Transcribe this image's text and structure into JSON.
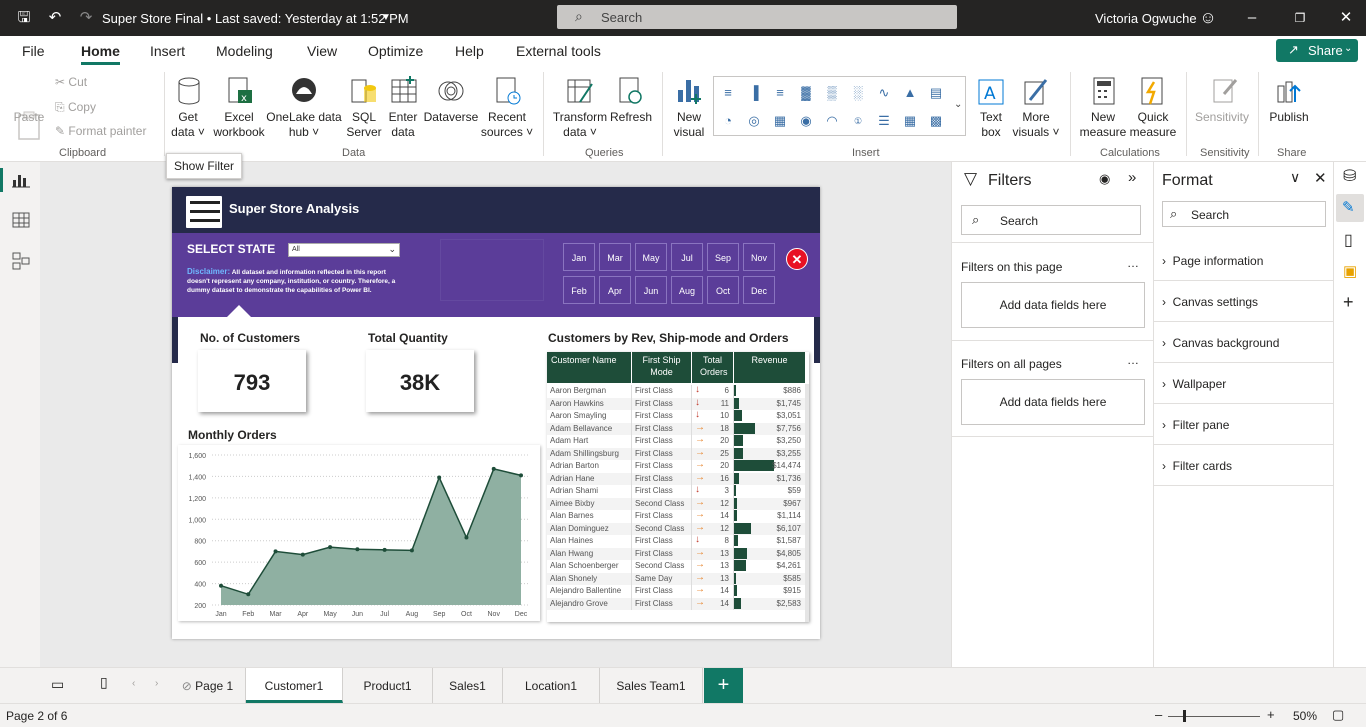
{
  "window": {
    "title": "Super Store Final • Last saved: Yesterday at 1:52 PM",
    "search_placeholder": "Search",
    "user_name": "Victoria Ogwuche"
  },
  "ribbon_tabs": [
    "File",
    "Home",
    "Insert",
    "Modeling",
    "View",
    "Optimize",
    "Help",
    "External tools"
  ],
  "share_label": "Share",
  "ribbon": {
    "clipboard": {
      "paste": "Paste",
      "cut": "Cut",
      "copy": "Copy",
      "format_painter": "Format painter",
      "group": "Clipboard"
    },
    "data": {
      "get_data": "Get data ˅",
      "excel": "Excel workbook",
      "onelake": "OneLake data hub ˅",
      "sql": "SQL Server",
      "enter": "Enter data",
      "dataverse": "Dataverse",
      "recent": "Recent sources ˅",
      "group": "Data"
    },
    "queries": {
      "transform": "Transform data ˅",
      "refresh": "Refresh",
      "group": "Queries"
    },
    "insert": {
      "new_visual": "New visual",
      "text_box": "Text box",
      "more_visuals": "More visuals ˅",
      "group": "Insert"
    },
    "calculations": {
      "new_measure": "New measure",
      "quick_measure": "Quick measure",
      "group": "Calculations"
    },
    "sensitivity": {
      "label": "Sensitivity",
      "group": "Sensitivity"
    },
    "share": {
      "publish": "Publish",
      "group": "Share"
    }
  },
  "tooltip": "Show Filter",
  "report": {
    "title": "Super Store Analysis",
    "select_state": "SELECT STATE",
    "state_value": "All",
    "disclaimer_label": "Disclaimer:",
    "disclaimer_text": "All dataset and information reflected in this report doesn't represent any company, institution, or country. Therefore, a dummy dataset to demonstrate the capabilities of Power BI.",
    "months_row1": [
      "Jan",
      "Mar",
      "May",
      "Jul",
      "Sep",
      "Nov"
    ],
    "months_row2": [
      "Feb",
      "Apr",
      "Jun",
      "Aug",
      "Oct",
      "Dec"
    ],
    "kpi_customers_title": "No. of Customers",
    "kpi_customers_value": "793",
    "kpi_quantity_title": "Total Quantity",
    "kpi_quantity_value": "38K",
    "table_title": "Customers by Rev, Ship-mode and Orders",
    "table_headers": [
      "Customer Name",
      "First Ship Mode",
      "Total Orders",
      "Revenue"
    ],
    "table_rows": [
      [
        "Aaron Bergman",
        "First Class",
        "down",
        "6",
        "$886"
      ],
      [
        "Aaron Hawkins",
        "First Class",
        "down",
        "11",
        "$1,745"
      ],
      [
        "Aaron Smayling",
        "First Class",
        "down",
        "10",
        "$3,051"
      ],
      [
        "Adam Bellavance",
        "First Class",
        "right",
        "18",
        "$7,756"
      ],
      [
        "Adam Hart",
        "First Class",
        "right",
        "20",
        "$3,250"
      ],
      [
        "Adam Shillingsburg",
        "First Class",
        "right",
        "25",
        "$3,255"
      ],
      [
        "Adrian Barton",
        "First Class",
        "right",
        "20",
        "$14,474"
      ],
      [
        "Adrian Hane",
        "First Class",
        "right",
        "16",
        "$1,736"
      ],
      [
        "Adrian Shami",
        "First Class",
        "down",
        "3",
        "$59"
      ],
      [
        "Aimee Bixby",
        "Second Class",
        "right",
        "12",
        "$967"
      ],
      [
        "Alan Barnes",
        "First Class",
        "right",
        "14",
        "$1,114"
      ],
      [
        "Alan Dominguez",
        "Second Class",
        "right",
        "12",
        "$6,107"
      ],
      [
        "Alan Haines",
        "First Class",
        "down",
        "8",
        "$1,587"
      ],
      [
        "Alan Hwang",
        "First Class",
        "right",
        "13",
        "$4,805"
      ],
      [
        "Alan Schoenberger",
        "Second Class",
        "right",
        "13",
        "$4,261"
      ],
      [
        "Alan Shonely",
        "Same Day",
        "right",
        "13",
        "$585"
      ],
      [
        "Alejandro Ballentine",
        "First Class",
        "right",
        "14",
        "$915"
      ],
      [
        "Alejandro Grove",
        "First Class",
        "right",
        "14",
        "$2,583"
      ]
    ],
    "chart_title": "Monthly Orders"
  },
  "chart_data": {
    "type": "area",
    "title": "Monthly Orders",
    "categories": [
      "Jan",
      "Feb",
      "Mar",
      "Apr",
      "May",
      "Jun",
      "Jul",
      "Aug",
      "Sep",
      "Oct",
      "Nov",
      "Dec"
    ],
    "values": [
      380,
      300,
      700,
      670,
      740,
      720,
      715,
      710,
      1390,
      830,
      1470,
      1410
    ],
    "yticks": [
      "1,600",
      "1,400",
      "1,200",
      "1,000",
      "800",
      "600",
      "400",
      "200"
    ],
    "ylim": [
      200,
      1600
    ],
    "color": "#8fb0a2",
    "line_color": "#1e4d39"
  },
  "filters_pane": {
    "title": "Filters",
    "search": "Search",
    "on_this_page": "Filters on this page",
    "on_all_pages": "Filters on all pages",
    "add_fields": "Add data fields here"
  },
  "format_pane": {
    "title": "Format",
    "search": "Search",
    "items": [
      "Page information",
      "Canvas settings",
      "Canvas background",
      "Wallpaper",
      "Filter pane",
      "Filter cards"
    ]
  },
  "page_tabs": [
    "Page 1",
    "Customer1",
    "Product1",
    "Sales1",
    "Location1",
    "Sales Team1"
  ],
  "status": {
    "page": "Page 2 of 6",
    "zoom": "50%"
  }
}
